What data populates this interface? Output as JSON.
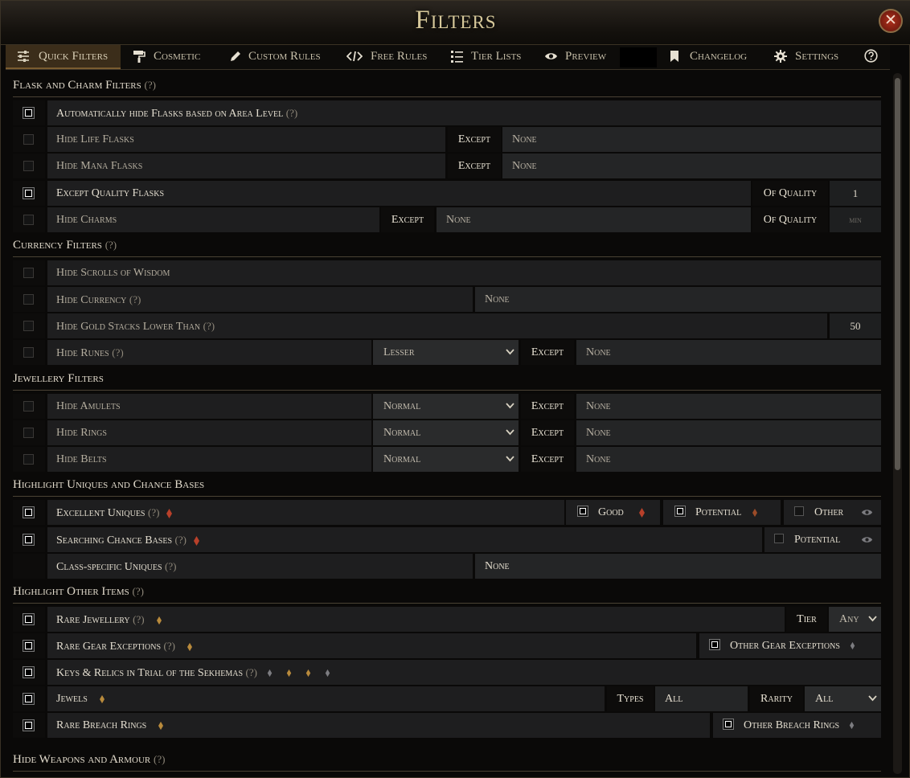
{
  "window": {
    "title": "Filters",
    "close_glyph": "✕"
  },
  "tabs": [
    {
      "label": "Quick Filters",
      "icon": "sliders-icon",
      "active": true
    },
    {
      "label": "Cosmetic",
      "icon": "paint-roller-icon"
    },
    {
      "label": "Custom Rules",
      "icon": "pencil-icon"
    },
    {
      "label": "Free Rules",
      "icon": "code-icon"
    },
    {
      "label": "Tier Lists",
      "icon": "list-icon"
    },
    {
      "label": "Preview",
      "icon": "eye-icon"
    },
    {
      "label": "Changelog",
      "icon": "bookmark-icon"
    },
    {
      "label": "Settings",
      "icon": "gear-icon"
    },
    {
      "label": "",
      "icon": "help-circle-icon"
    }
  ],
  "help_mark": "(?)",
  "sections": {
    "flask": "Flask and Charm Filters",
    "currency": "Currency Filters",
    "jewellery": "Jewellery Filters",
    "uniques": "Highlight Uniques and Chance Bases",
    "other": "Highlight Other Items",
    "weapons": "Hide Weapons and Armour"
  },
  "words": {
    "except": "Except",
    "none": "None",
    "of_quality": "Of Quality",
    "min": "min",
    "tier": "Tier",
    "types": "Types",
    "rarity": "Rarity"
  },
  "flask": {
    "auto_hide": {
      "label": "Automatically hide Flasks based on Area Level",
      "checked": true
    },
    "hide_life": {
      "label": "Hide Life Flasks",
      "checked": false
    },
    "hide_mana": {
      "label": "Hide Mana Flasks",
      "checked": false
    },
    "except_quality": {
      "label": "Except Quality Flasks",
      "checked": true,
      "quality": "1"
    },
    "hide_charms": {
      "label": "Hide Charms",
      "checked": false
    }
  },
  "currency": {
    "scrolls": {
      "label": "Hide Scrolls of Wisdom",
      "checked": false
    },
    "hide_currency": {
      "label": "Hide Currency",
      "checked": false
    },
    "gold": {
      "label": "Hide Gold Stacks Lower Than",
      "checked": false,
      "value": "50"
    },
    "runes": {
      "label": "Hide Runes",
      "checked": false,
      "select": "Lesser"
    }
  },
  "jewellery": {
    "amulets": {
      "label": "Hide Amulets",
      "checked": false,
      "select": "Normal"
    },
    "rings": {
      "label": "Hide Rings",
      "checked": false,
      "select": "Normal"
    },
    "belts": {
      "label": "Hide Belts",
      "checked": false,
      "select": "Normal"
    }
  },
  "uniques": {
    "excellent": {
      "label": "Excellent Uniques",
      "checked": true,
      "good": "Good",
      "potential": "Potential",
      "other": "Other"
    },
    "chance": {
      "label": "Searching Chance Bases",
      "checked": true,
      "potential": "Potential"
    },
    "class_specific": {
      "label": "Class-specific Uniques",
      "value": "None"
    }
  },
  "other_items": {
    "rare_jewellery": {
      "label": "Rare Jewellery",
      "checked": true,
      "tier": "Any"
    },
    "rare_gear": {
      "label": "Rare Gear Exceptions",
      "checked": true,
      "other_label": "Other Gear Exceptions"
    },
    "keys": {
      "label": "Keys & Relics in Trial of the Sekhemas",
      "checked": true
    },
    "jewels": {
      "label": "Jewels",
      "checked": true,
      "types": "All",
      "rarity": "All"
    },
    "breach": {
      "label": "Rare Breach Rings",
      "checked": true,
      "other_label": "Other Breach Rings"
    }
  },
  "colors": {
    "accent": "#7a5c30",
    "drop_red": "#b8402a",
    "drop_gold": "#b88a3c",
    "drop_grey": "#7c7c80"
  }
}
